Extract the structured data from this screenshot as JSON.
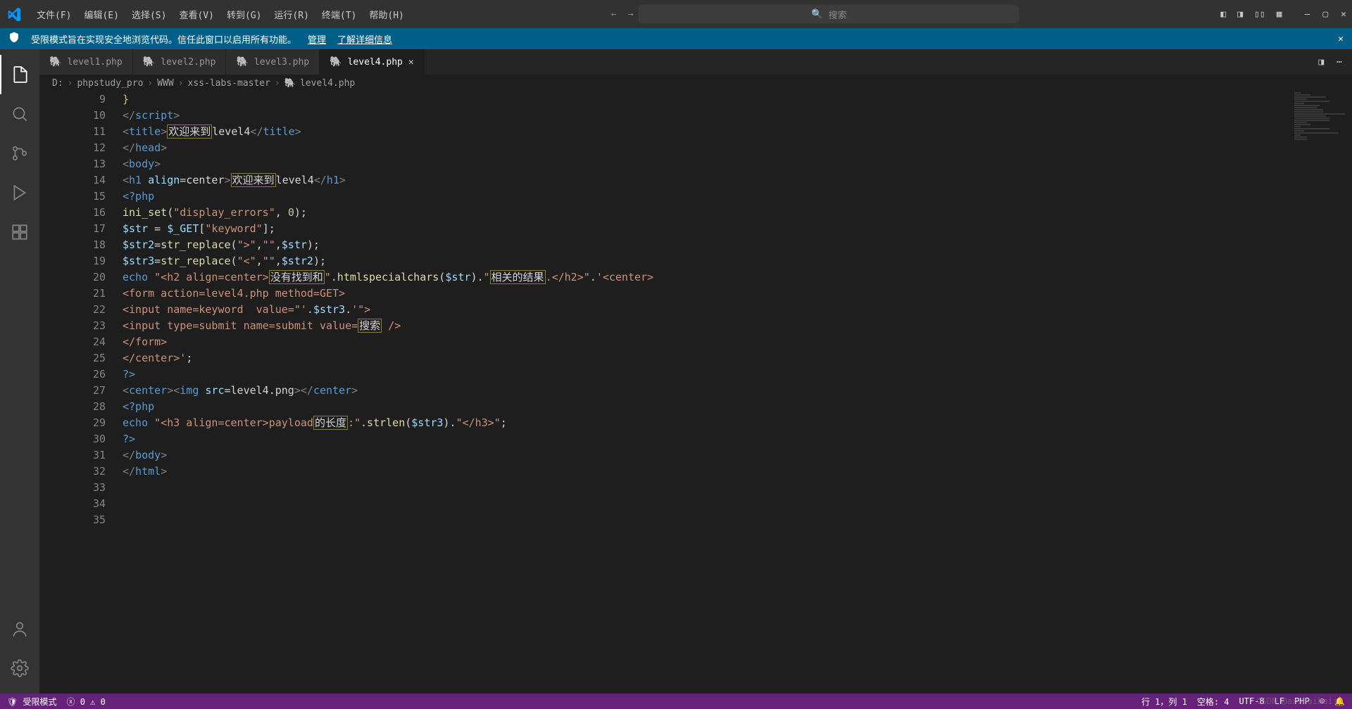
{
  "menu": {
    "items": [
      "文件(F)",
      "编辑(E)",
      "选择(S)",
      "查看(V)",
      "转到(G)",
      "运行(R)",
      "终端(T)",
      "帮助(H)"
    ]
  },
  "search": {
    "placeholder": "搜索"
  },
  "notification": {
    "message": "受限模式旨在实现安全地浏览代码。信任此窗口以启用所有功能。",
    "manage": "管理",
    "learn_more": "了解详细信息"
  },
  "tabs": [
    {
      "label": "level1.php",
      "active": false
    },
    {
      "label": "level2.php",
      "active": false
    },
    {
      "label": "level3.php",
      "active": false
    },
    {
      "label": "level4.php",
      "active": true
    }
  ],
  "breadcrumb": {
    "parts": [
      "D:",
      "phpstudy_pro",
      "WWW",
      "xss-labs-master",
      "level4.php"
    ]
  },
  "editor": {
    "first_line": 9,
    "lines_html": [
      "<span class='tk-yellow'>}</span>",
      "<span class='tk-gray'>&lt;/</span><span class='tk-tag'>script</span><span class='tk-gray'>&gt;</span>",
      "<span class='tk-gray'>&lt;</span><span class='tk-tag'>title</span><span class='tk-gray'>&gt;</span><span class='highlight-box'>欢迎来到</span><span class='tk-txt'>level4</span><span class='tk-gray'>&lt;/</span><span class='tk-tag'>title</span><span class='tk-gray'>&gt;</span>",
      "<span class='tk-gray'>&lt;/</span><span class='tk-tag'>head</span><span class='tk-gray'>&gt;</span>",
      "<span class='tk-gray'>&lt;</span><span class='tk-tag'>body</span><span class='tk-gray'>&gt;</span>",
      "<span class='tk-gray'>&lt;</span><span class='tk-tag'>h1</span> <span class='tk-attr'>align</span><span class='tk-txt'>=</span><span class='tk-txt'>center</span><span class='tk-gray'>&gt;</span><span class='highlight-box'>欢迎来到</span><span class='tk-txt'>level4</span><span class='tk-gray'>&lt;/</span><span class='tk-tag'>h1</span><span class='tk-gray'>&gt;</span>",
      "<span class='tk-kw'>&lt;?php</span>",
      "<span class='tk-fn'>ini_set</span><span class='tk-txt'>(</span><span class='tk-str'>\"display_errors\"</span><span class='tk-txt'>, </span><span class='tk-num'>0</span><span class='tk-txt'>);</span>",
      "<span class='tk-var'>$str</span><span class='tk-txt'> = </span><span class='tk-var'>$_GET</span><span class='tk-txt'>[</span><span class='tk-str'>\"keyword\"</span><span class='tk-txt'>];</span>",
      "<span class='tk-var'>$str2</span><span class='tk-txt'>=</span><span class='tk-fn'>str_replace</span><span class='tk-txt'>(</span><span class='tk-str'>\"&gt;\"</span><span class='tk-txt'>,</span><span class='tk-str'>\"\"</span><span class='tk-txt'>,</span><span class='tk-var'>$str</span><span class='tk-txt'>);</span>",
      "<span class='tk-var'>$str3</span><span class='tk-txt'>=</span><span class='tk-fn'>str_replace</span><span class='tk-txt'>(</span><span class='tk-str'>\"&lt;\"</span><span class='tk-txt'>,</span><span class='tk-str'>\"\"</span><span class='tk-txt'>,</span><span class='tk-var'>$str2</span><span class='tk-txt'>);</span>",
      "<span class='tk-kw'>echo</span><span class='tk-txt'> </span><span class='tk-str'>\"&lt;h2 align=center&gt;</span><span class='highlight-box'>没有找到和</span><span class='tk-str'>\"</span><span class='tk-txt'>.</span><span class='tk-fn'>htmlspecialchars</span><span class='tk-txt'>(</span><span class='tk-var'>$str</span><span class='tk-txt'>).</span><span class='tk-str'>\"</span><span class='highlight-box'>相关的结果</span><span class='tk-str'>.&lt;/h2&gt;\"</span><span class='tk-txt'>.</span><span class='tk-str'>'&lt;center&gt;</span>",
      "<span class='tk-str'>&lt;form action=level4.php method=GET&gt;</span>",
      "<span class='tk-str'>&lt;input name=keyword  value=\"'</span><span class='tk-txt'>.</span><span class='tk-var'>$str3</span><span class='tk-txt'>.</span><span class='tk-str'>'\"&gt;</span>",
      "<span class='tk-str'>&lt;input type=submit name=submit value=</span><span class='highlight-box'>搜索</span><span class='tk-str'> /&gt;</span>",
      "<span class='tk-str'>&lt;/form&gt;</span>",
      "<span class='tk-str'>&lt;/center&gt;'</span><span class='tk-txt'>;</span>",
      "<span class='tk-kw'>?&gt;</span>",
      "<span class='tk-gray'>&lt;</span><span class='tk-tag'>center</span><span class='tk-gray'>&gt;&lt;</span><span class='tk-tag'>img</span> <span class='tk-attr'>src</span><span class='tk-txt'>=level4.png</span><span class='tk-gray'>&gt;&lt;/</span><span class='tk-tag'>center</span><span class='tk-gray'>&gt;</span>",
      "<span class='tk-kw'>&lt;?php</span>",
      "<span class='tk-kw'>echo</span><span class='tk-txt'> </span><span class='tk-str'>\"&lt;h3 align=center&gt;payload</span><span class='highlight-box'>的长度</span><span class='tk-str'>:\"</span><span class='tk-txt'>.</span><span class='tk-fn'>strlen</span><span class='tk-txt'>(</span><span class='tk-var'>$str3</span><span class='tk-txt'>).</span><span class='tk-str'>\"&lt;/h3&gt;\"</span><span class='tk-txt'>;</span>",
      "<span class='tk-kw'>?&gt;</span>",
      "<span class='tk-gray'>&lt;/</span><span class='tk-tag'>body</span><span class='tk-gray'>&gt;</span>",
      "<span class='tk-gray'>&lt;/</span><span class='tk-tag'>html</span><span class='tk-gray'>&gt;</span>",
      "",
      "",
      ""
    ]
  },
  "statusbar": {
    "restricted": "受限模式",
    "errors": "0",
    "warnings": "0",
    "ln_col": "行 1，列 1",
    "spaces": "空格: 4",
    "encoding": "UTF-8",
    "eol": "LF",
    "lang": "PHP"
  },
  "watermark": "CSDN @axihaihaii"
}
